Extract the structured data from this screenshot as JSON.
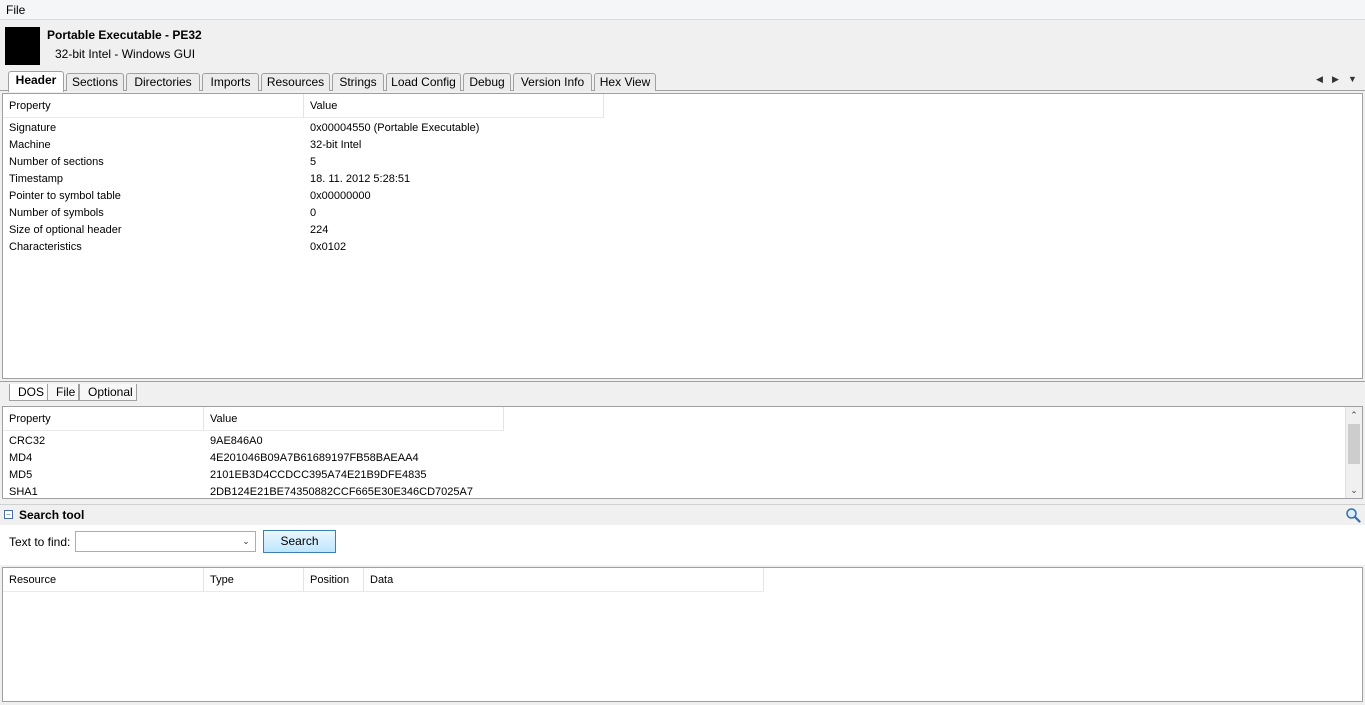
{
  "menu": {
    "file": "File"
  },
  "header": {
    "title": "Portable Executable - PE32",
    "subtitle": "32-bit Intel - Windows GUI"
  },
  "tabs": [
    {
      "label": "Header",
      "active": true
    },
    {
      "label": "Sections"
    },
    {
      "label": "Directories"
    },
    {
      "label": "Imports"
    },
    {
      "label": "Resources"
    },
    {
      "label": "Strings"
    },
    {
      "label": "Load Config"
    },
    {
      "label": "Debug"
    },
    {
      "label": "Version Info"
    },
    {
      "label": "Hex View"
    }
  ],
  "header_table": {
    "columns": [
      "Property",
      "Value"
    ],
    "rows": [
      [
        "Signature",
        "0x00004550 (Portable Executable)"
      ],
      [
        "Machine",
        "32-bit Intel"
      ],
      [
        "Number of sections",
        "5"
      ],
      [
        "Timestamp",
        "18. 11. 2012 5:28:51"
      ],
      [
        "Pointer to symbol table",
        "0x00000000"
      ],
      [
        "Number of symbols",
        "0"
      ],
      [
        "Size of optional header",
        "224"
      ],
      [
        "Characteristics",
        "0x0102"
      ]
    ]
  },
  "subtabs": [
    {
      "label": "DOS"
    },
    {
      "label": "File"
    },
    {
      "label": "Optional"
    }
  ],
  "hash_table": {
    "columns": [
      "Property",
      "Value"
    ],
    "rows": [
      [
        "CRC32",
        "9AE846A0"
      ],
      [
        "MD4",
        "4E201046B09A7B61689197FB58BAEAA4"
      ],
      [
        "MD5",
        "2101EB3D4CCDCC395A74E21B9DFE4835"
      ],
      [
        "SHA1",
        "2DB124E21BE74350882CCF665E30E346CD7025A7"
      ]
    ]
  },
  "search_tool": {
    "title": "Search tool",
    "label": "Text to find:",
    "input_value": "",
    "button": "Search",
    "results_columns": [
      "Resource",
      "Type",
      "Position",
      "Data"
    ]
  },
  "icons": {
    "collapse": "minus-box-icon",
    "magnify": "magnifier-icon",
    "tab_prev": "triangle-left-icon",
    "tab_next": "triangle-right-icon",
    "tab_menu": "triangle-down-icon"
  }
}
